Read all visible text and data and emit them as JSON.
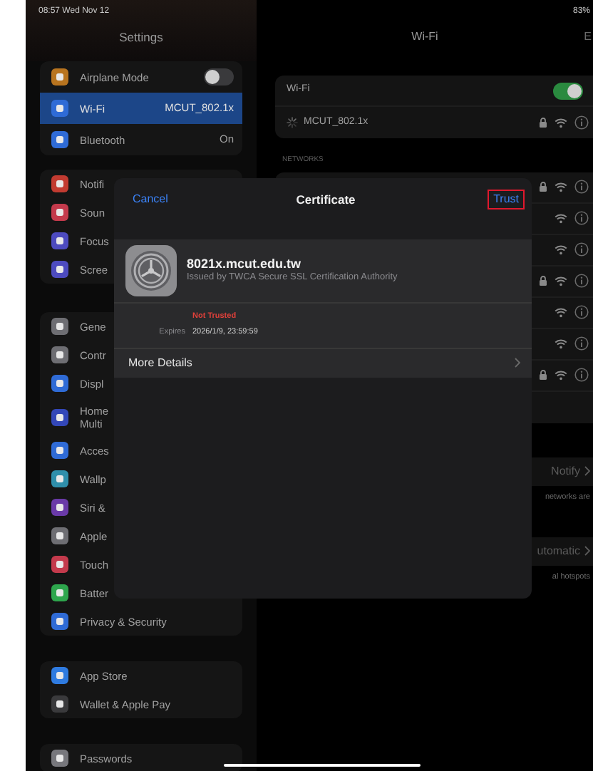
{
  "status_bar": {
    "time": "08:57",
    "date": "Wed Nov 12",
    "battery": "83%"
  },
  "sidebar": {
    "title": "Settings",
    "groups": [
      [
        {
          "label": "Airplane Mode",
          "kind": "toggle",
          "on": false,
          "color": "#b8741f",
          "selected": false
        },
        {
          "label": "Wi-Fi",
          "kind": "detail",
          "value": "MCUT_802.1x",
          "color": "#2f6bd6",
          "selected": true
        },
        {
          "label": "Bluetooth",
          "kind": "detail",
          "value": "On",
          "color": "#2f6bd6",
          "selected": false
        }
      ],
      [
        {
          "label": "Notifi",
          "kind": "plain",
          "color": "#c23b31",
          "selected": false
        },
        {
          "label": "Soun",
          "kind": "plain",
          "color": "#c43a4c",
          "selected": false
        },
        {
          "label": "Focus",
          "kind": "plain",
          "color": "#4d4bbf",
          "selected": false
        },
        {
          "label": "Scree",
          "kind": "plain",
          "color": "#4d4bbf",
          "selected": false
        }
      ],
      [
        {
          "label": "Gene",
          "kind": "plain",
          "color": "#6e6e73",
          "selected": false
        },
        {
          "label": "Contr",
          "kind": "plain",
          "color": "#6e6e73",
          "selected": false
        },
        {
          "label": "Displ",
          "kind": "plain",
          "color": "#2f6bd6",
          "selected": false
        },
        {
          "label": "Home\nMulti",
          "kind": "plain",
          "color": "#3347b8",
          "selected": false
        },
        {
          "label": "Acces",
          "kind": "plain",
          "color": "#2f6bd6",
          "selected": false
        },
        {
          "label": "Wallp",
          "kind": "plain",
          "color": "#2f8fab",
          "selected": false
        },
        {
          "label": "Siri &",
          "kind": "plain",
          "color": "#6a3aa8",
          "selected": false
        },
        {
          "label": "Apple",
          "kind": "plain",
          "color": "#6e6e73",
          "selected": false
        },
        {
          "label": "Touch",
          "kind": "plain",
          "color": "#c43a4c",
          "selected": false
        },
        {
          "label": "Batter",
          "kind": "plain",
          "color": "#2ea64d",
          "selected": false
        },
        {
          "label": "Privacy & Security",
          "kind": "plain",
          "color": "#2f6bd6",
          "selected": false
        }
      ],
      [
        {
          "label": "App Store",
          "kind": "plain",
          "color": "#2f7be0",
          "selected": false
        },
        {
          "label": "Wallet & Apple Pay",
          "kind": "plain",
          "color": "#3a3a3c",
          "selected": false
        }
      ],
      [
        {
          "label": "Passwords",
          "kind": "plain",
          "color": "#77777c",
          "selected": false
        }
      ]
    ]
  },
  "wifi": {
    "title": "Wi-Fi",
    "edit": "E",
    "toggle": {
      "label": "Wi-Fi",
      "on": true
    },
    "current": {
      "name": "MCUT_802.1x",
      "connecting": true,
      "locked": true
    },
    "networks_label": "NETWORKS",
    "networks": [
      {
        "locked": true
      },
      {
        "locked": false
      },
      {
        "locked": false
      },
      {
        "locked": true
      },
      {
        "locked": false
      },
      {
        "locked": false
      },
      {
        "locked": true
      }
    ],
    "settings": [
      {
        "value": "Notify",
        "caption": "networks are"
      },
      {
        "value": "utomatic",
        "caption": "al hotspots"
      }
    ]
  },
  "certificate": {
    "cancel": "Cancel",
    "title": "Certificate",
    "trust": "Trust",
    "trust_highlighted": true,
    "name": "8021x.mcut.edu.tw",
    "issuer": "Issued by TWCA Secure SSL Certification Authority",
    "trust_status": "Not Trusted",
    "expires_label": "Expires",
    "expires": "2026/1/9, 23:59:59",
    "more": "More Details"
  }
}
